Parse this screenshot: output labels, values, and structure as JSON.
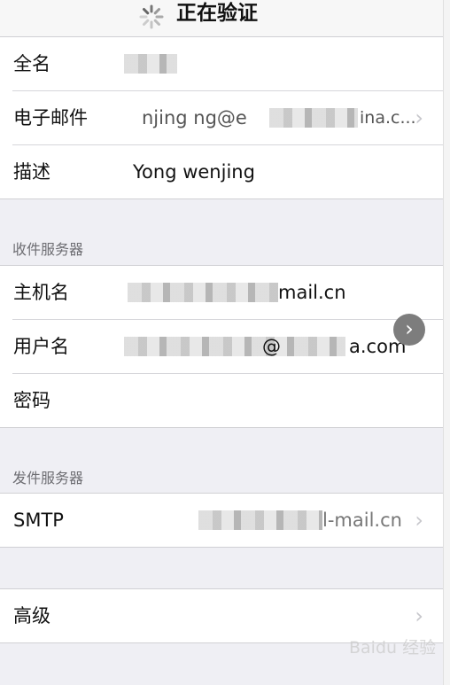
{
  "header": {
    "title": "正在验证"
  },
  "account": {
    "fullname_label": "全名",
    "email_label": "电子邮件",
    "email_value_visible": "njing ng@e",
    "email_value_suffix": "ina.c...",
    "description_label": "描述",
    "description_value": "Yong wenjing"
  },
  "incoming": {
    "section_title": "收件服务器",
    "host_label": "主机名",
    "host_value_suffix": "mail.cn",
    "user_label": "用户名",
    "user_value_mid": "@",
    "user_value_suffix": "a.com",
    "password_label": "密码"
  },
  "outgoing": {
    "section_title": "发件服务器",
    "smtp_label": "SMTP",
    "smtp_value_suffix": "l-mail.cn"
  },
  "advanced": {
    "label": "高级"
  },
  "watermark": "Baidu 经验"
}
